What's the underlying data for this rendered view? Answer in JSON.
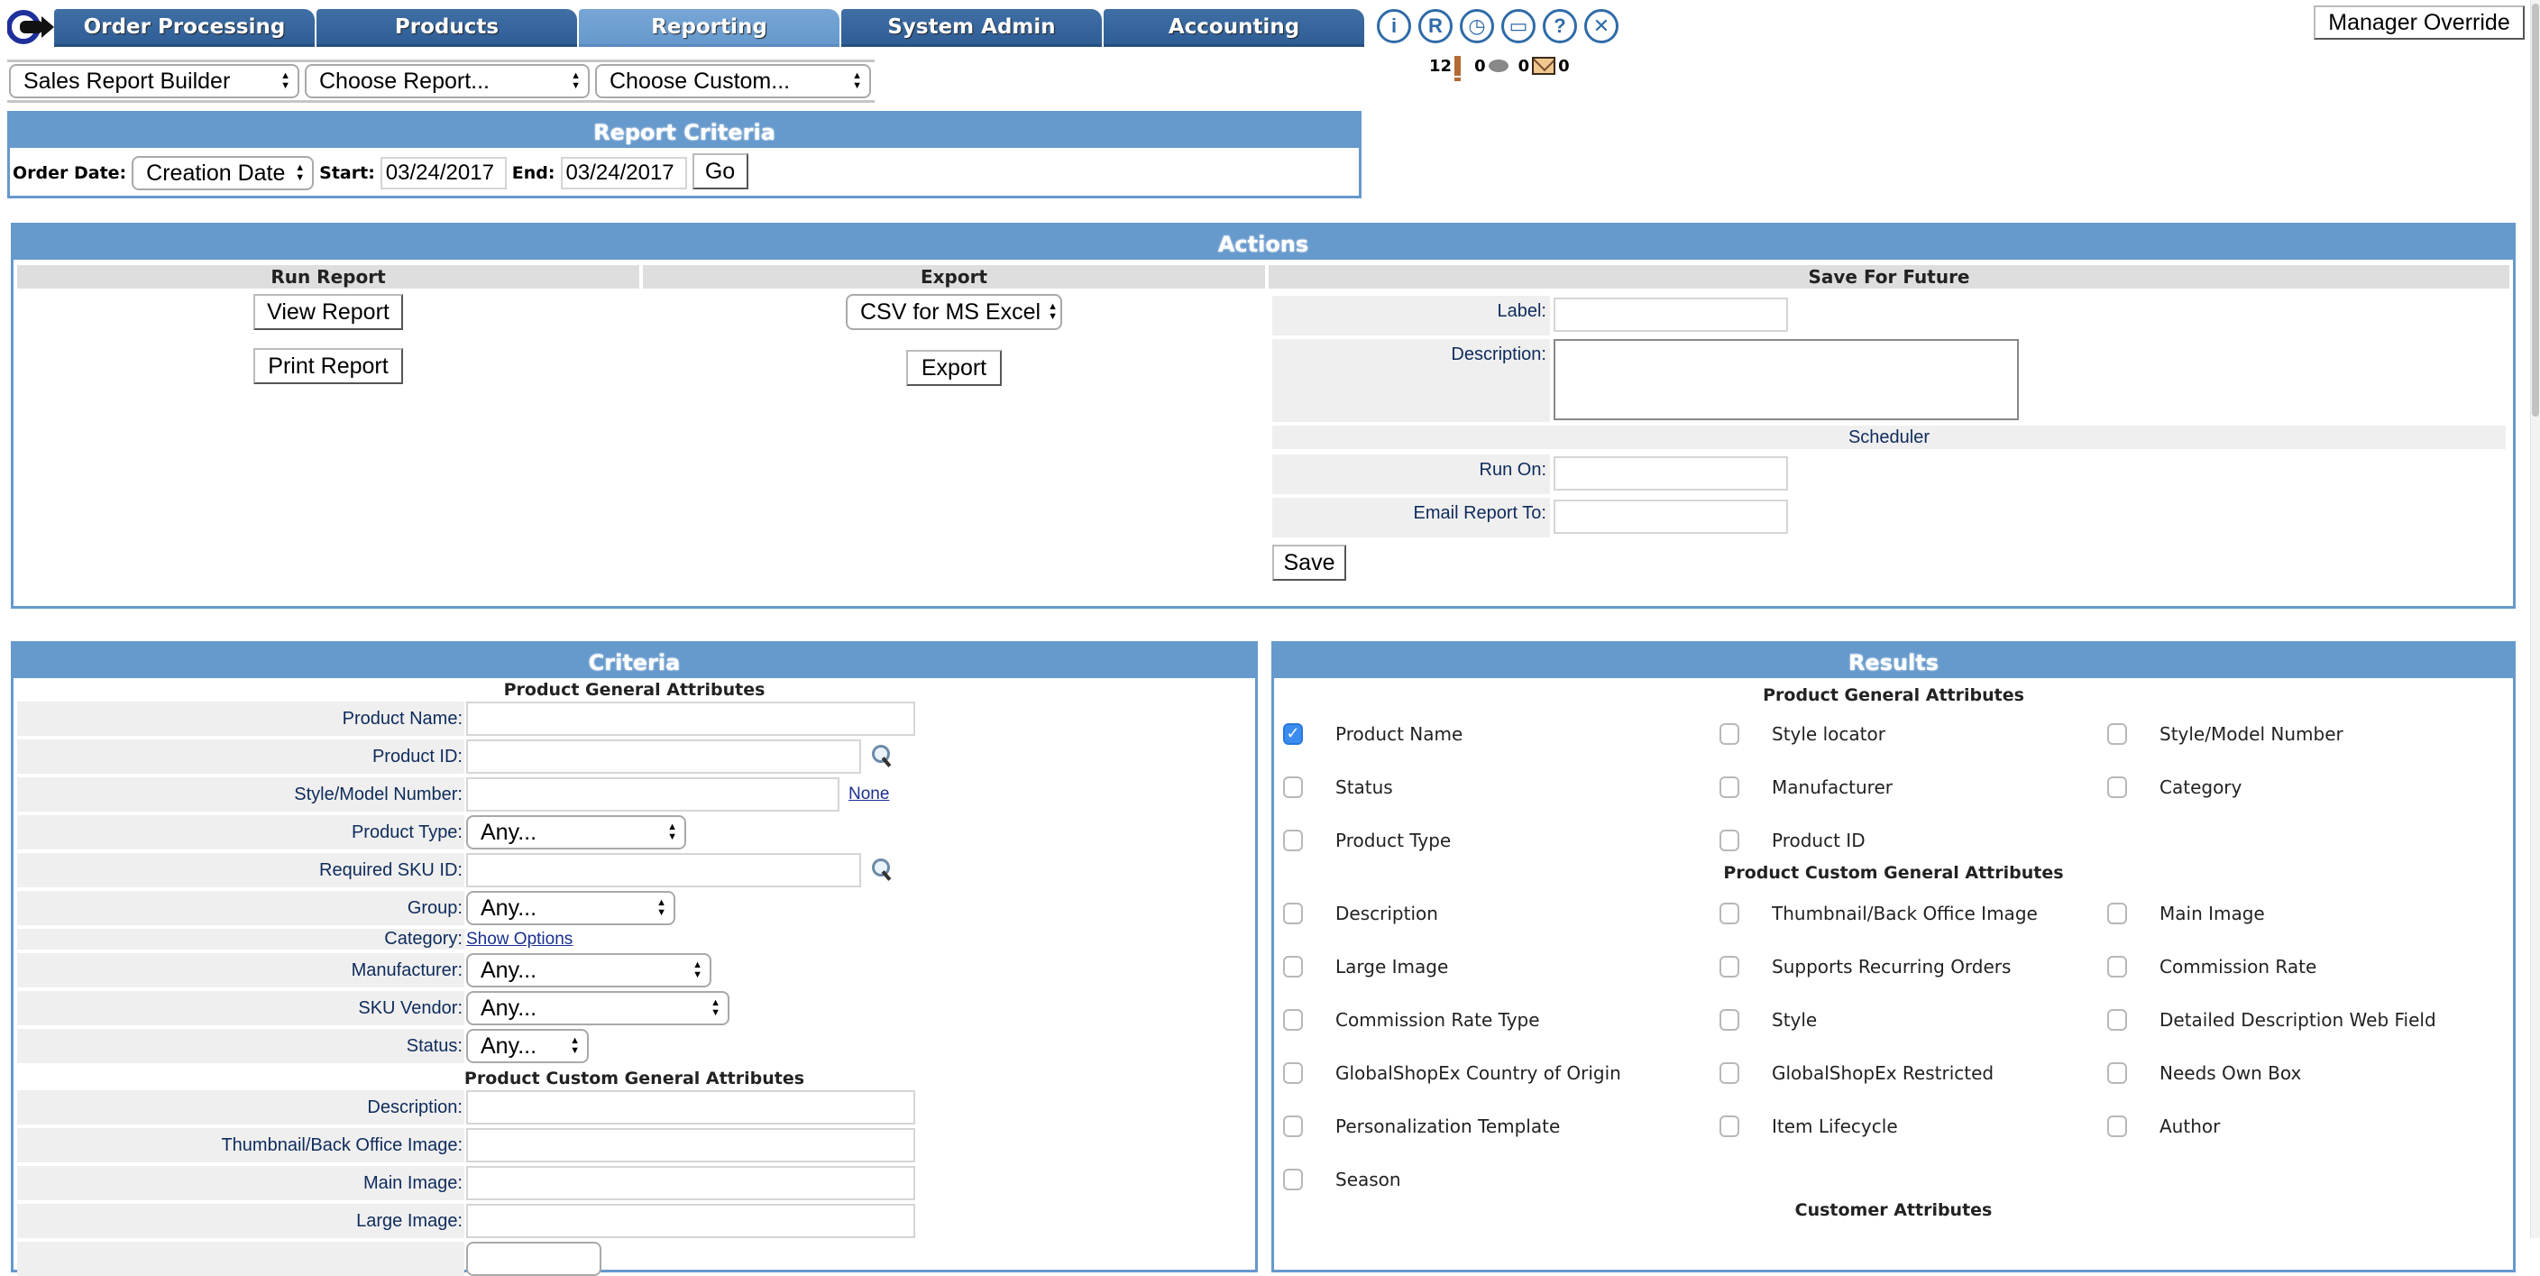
{
  "nav": {
    "tabs": [
      {
        "label": "Order Processing",
        "active": false
      },
      {
        "label": "Products",
        "active": false
      },
      {
        "label": "Reporting",
        "active": true
      },
      {
        "label": "System Admin",
        "active": false
      },
      {
        "label": "Accounting",
        "active": false
      }
    ],
    "tool_icons": [
      {
        "name": "user-info-icon",
        "glyph": "i"
      },
      {
        "name": "registered-icon",
        "glyph": "R"
      },
      {
        "name": "clock-icon",
        "glyph": "◷"
      },
      {
        "name": "terminal-icon",
        "glyph": "▭"
      },
      {
        "name": "help-icon",
        "glyph": "?"
      },
      {
        "name": "close-icon",
        "glyph": "✕"
      }
    ],
    "alerts": {
      "alert_count": "12",
      "chat_count": "0",
      "message_count": "0",
      "mail_count": "0"
    },
    "manager_override_label": "Manager Override"
  },
  "pickers": {
    "report_type": "Sales Report Builder",
    "report": "Choose Report...",
    "custom": "Choose Custom..."
  },
  "report_criteria": {
    "title": "Report Criteria",
    "order_date_label": "Order Date:",
    "order_date_value": "Creation Date",
    "start_label": "Start:",
    "start_value": "03/24/2017",
    "end_label": "End:",
    "end_value": "03/24/2017",
    "go_label": "Go"
  },
  "actions": {
    "title": "Actions",
    "run_report": {
      "heading": "Run Report",
      "view_label": "View Report",
      "print_label": "Print Report"
    },
    "export": {
      "heading": "Export",
      "format_value": "CSV for MS Excel",
      "export_label": "Export"
    },
    "save_for_future": {
      "heading": "Save For Future",
      "label_label": "Label:",
      "label_value": "",
      "description_label": "Description:",
      "description_value": "",
      "scheduler_heading": "Scheduler",
      "run_on_label": "Run On:",
      "run_on_value": "",
      "email_label": "Email Report To:",
      "email_value": "",
      "save_label": "Save"
    }
  },
  "criteria": {
    "title": "Criteria",
    "general_heading": "Product General Attributes",
    "product_name_label": "Product Name:",
    "product_id_label": "Product ID:",
    "style_model_label": "Style/Model Number:",
    "style_model_link": "None",
    "product_type_label": "Product Type:",
    "product_type_value": "Any...",
    "required_sku_label": "Required SKU ID:",
    "group_label": "Group:",
    "group_value": "Any...",
    "category_label": "Category:",
    "category_link": "Show Options",
    "manufacturer_label": "Manufacturer:",
    "manufacturer_value": "Any...",
    "sku_vendor_label": "SKU Vendor:",
    "sku_vendor_value": "Any...",
    "status_label": "Status:",
    "status_value": "Any...",
    "custom_heading": "Product Custom General Attributes",
    "description_label": "Description:",
    "thumbnail_label": "Thumbnail/Back Office Image:",
    "main_image_label": "Main Image:",
    "large_image_label": "Large Image:"
  },
  "results": {
    "title": "Results",
    "general_heading": "Product General Attributes",
    "general_items": [
      {
        "label": "Product Name",
        "checked": true
      },
      {
        "label": "Style locator",
        "checked": false
      },
      {
        "label": "Style/Model Number",
        "checked": false
      },
      {
        "label": "Status",
        "checked": false
      },
      {
        "label": "Manufacturer",
        "checked": false
      },
      {
        "label": "Category",
        "checked": false
      },
      {
        "label": "Product Type",
        "checked": false
      },
      {
        "label": "Product ID",
        "checked": false
      }
    ],
    "custom_heading": "Product Custom General Attributes",
    "custom_items": [
      {
        "label": "Description",
        "checked": false
      },
      {
        "label": "Thumbnail/Back Office Image",
        "checked": false
      },
      {
        "label": "Main Image",
        "checked": false
      },
      {
        "label": "Large Image",
        "checked": false
      },
      {
        "label": "Supports Recurring Orders",
        "checked": false
      },
      {
        "label": "Commission Rate",
        "checked": false
      },
      {
        "label": "Commission Rate Type",
        "checked": false
      },
      {
        "label": "Style",
        "checked": false
      },
      {
        "label": "Detailed Description Web Field",
        "checked": false
      },
      {
        "label": "GlobalShopEx Country of Origin",
        "checked": false
      },
      {
        "label": "GlobalShopEx Restricted",
        "checked": false
      },
      {
        "label": "Needs Own Box",
        "checked": false
      },
      {
        "label": "Personalization Template",
        "checked": false
      },
      {
        "label": "Item Lifecycle",
        "checked": false
      },
      {
        "label": "Author",
        "checked": false
      },
      {
        "label": "Season",
        "checked": false
      }
    ],
    "customer_heading": "Customer Attributes"
  },
  "colors": {
    "tab_blue": "#2f5e96",
    "tab_active": "#6699cc",
    "panel_header": "#6699cc",
    "label_navy": "#0e2b5c",
    "checkbox_checked": "#3b8cf0"
  }
}
